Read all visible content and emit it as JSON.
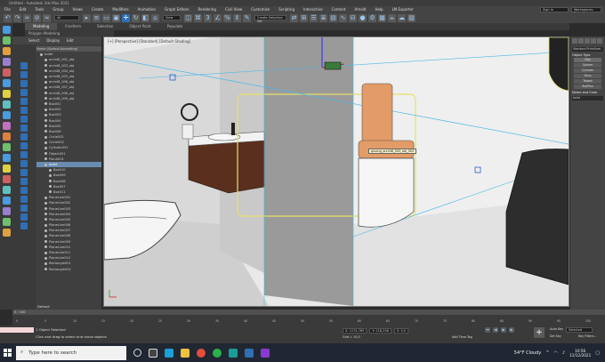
{
  "window": {
    "title": "Untitled - Autodesk 3ds Max 2021"
  },
  "menu": [
    "File",
    "Edit",
    "Tools",
    "Group",
    "Views",
    "Create",
    "Modifiers",
    "Animation",
    "Graph Editors",
    "Rendering",
    "Civil View",
    "Customize",
    "Scripting",
    "Interactive",
    "Content",
    "Arnold",
    "Help",
    "LM Exporter"
  ],
  "menu_right": {
    "signin": "Sign In",
    "workspace": "Workspaces: Default"
  },
  "toolbar": {
    "selection_filter": "All",
    "view_select": "View",
    "named_selection": "Create Selection Set"
  },
  "ribbon": {
    "tabs": [
      "Modeling",
      "Freeform",
      "Selection",
      "Object Paint",
      "Populate"
    ],
    "active": "Modeling",
    "sub": "Polygon Modeling"
  },
  "explorer": {
    "menu": [
      "Select",
      "Display",
      "Edit"
    ],
    "root": "Name (Sorted Ascending)",
    "items": [
      "toilet",
      "arch48_001_obj",
      "arch48_003_obj",
      "arch48_004_obj",
      "arch48_005_obj",
      "arch48_006_obj",
      "arch48_007_obj",
      "arch48_008_obj",
      "arch48_009_obj",
      "Box001",
      "Box002",
      "Box003",
      "Box004",
      "Box005",
      "Box006",
      "Circle001",
      "Circle002",
      "Cylinder001",
      "Object001",
      "PlanA001",
      "toilet",
      "Box010",
      "Box009",
      "Box008",
      "Box007",
      "Box011",
      "PlaneLine001",
      "PlaneLine002",
      "PlaneLine003",
      "PlaneLine004",
      "PlaneLine005",
      "PlaneLine006",
      "PlaneLine007",
      "PlaneLine008",
      "PlaneLine009",
      "PlaneLine010",
      "PlaneLine011",
      "PlaneLine012",
      "Rectangle001",
      "Rectangle002"
    ],
    "selected_index": 20,
    "footer": "Default"
  },
  "viewport": {
    "label": "[+] [Perspective] [Standard] [Default Shading]",
    "tooltip": "giuong_arch48_003_obj_005"
  },
  "cmdpanel": {
    "dropdown": "Standard Primitives",
    "section1": "Object Type",
    "buttons": [
      "Box",
      "Sphere",
      "Cylinder",
      "Torus",
      "Teapot",
      "TextPlus"
    ],
    "section2": "Name and Color",
    "name": "toilet"
  },
  "timeline": {
    "frame": "0 / 100",
    "ticks": [
      "0",
      "5",
      "10",
      "15",
      "20",
      "25",
      "30",
      "35",
      "40",
      "45",
      "50",
      "55",
      "60",
      "65",
      "70",
      "75",
      "80",
      "85",
      "90",
      "95",
      "100"
    ]
  },
  "status": {
    "line1": "1 Object Selected",
    "line2": "Click and drag to select and move objects",
    "x": "X: 1174,765",
    "y": "Y: 218,258",
    "z": "Z: 0,0",
    "grid": "Grid = 10,0",
    "addtime": "Add Time Tag",
    "autokey": "Auto Key",
    "setkey": "Set Key",
    "selected": "Selected",
    "keyfilters": "Key Filters..."
  },
  "taskbar": {
    "search_placeholder": "Type here to search",
    "weather": "54°F  Cloudy",
    "time": "10:56",
    "date": "11/12/2021"
  },
  "colors": {
    "ui_dark": "#2b2b2b",
    "accent_blue": "#2f6fb5",
    "seat_cushion": "#e39b67",
    "vanity_wood": "#5a2f1e",
    "selection_yellow": "#e8e06a"
  }
}
